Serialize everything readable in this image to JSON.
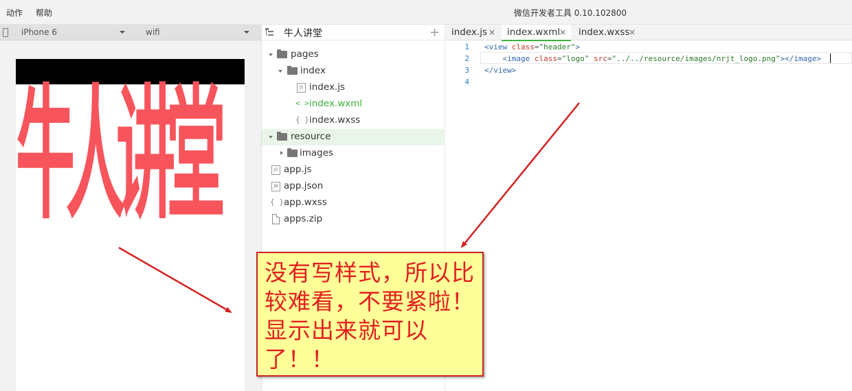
{
  "menu": {
    "action": "动作",
    "help": "帮助"
  },
  "app_title": "微信开发者工具 0.10.102800",
  "simulator": {
    "device_select": "iPhone 6",
    "network_select": "wifi",
    "logo_text": "牛人讲堂"
  },
  "file_tree": {
    "project_name": "牛人讲堂",
    "rows": [
      {
        "label": "pages",
        "icon": "folder-icon"
      },
      {
        "label": "index",
        "icon": "folder-icon"
      },
      {
        "label": "index.js",
        "icon": "js-file-icon",
        "badge": "JS"
      },
      {
        "label": "index.wxml",
        "icon": "code-tag-icon",
        "glyph": "< >"
      },
      {
        "label": "index.wxss",
        "icon": "braces-icon",
        "glyph": "{ }"
      },
      {
        "label": "resource",
        "icon": "folder-icon"
      },
      {
        "label": "images",
        "icon": "folder-icon"
      },
      {
        "label": "app.js",
        "icon": "js-file-icon",
        "badge": "JS"
      },
      {
        "label": "app.json",
        "icon": "json-file-icon",
        "badge": "JN"
      },
      {
        "label": "app.wxss",
        "icon": "braces-icon",
        "glyph": "{ }"
      },
      {
        "label": "apps.zip",
        "icon": "file-icon"
      }
    ]
  },
  "editor": {
    "tabs": [
      {
        "label": "index.js",
        "close": "×"
      },
      {
        "label": "index.wxml",
        "close": "×"
      },
      {
        "label": "index.wxss",
        "close": "×"
      }
    ],
    "line_numbers": [
      "1",
      "2",
      "3",
      "4"
    ],
    "code": {
      "l1_open": "<view ",
      "l1_attr": "class",
      "l1_eq": "=",
      "l1_val": "\"header\"",
      "l1_close": ">",
      "l2_indent": "    ",
      "l2_open": "<image ",
      "l2_attr1": "class",
      "l2_eq1": "=",
      "l2_val1": "\"logo\"",
      "l2_sp": " ",
      "l2_attr2": "src",
      "l2_eq2": "=",
      "l2_val2": "\"../../resource/images/nrjt_logo.png\"",
      "l2_close": "></image>",
      "l3": "</view>"
    }
  },
  "annotation": {
    "text": "没有写样式，所以比较难看，不要紧啦！显示出来就可以了！！"
  },
  "colors": {
    "accent_green": "#3cb13c",
    "logo_red": "#f7545c",
    "callout_bg": "#ffff99",
    "callout_text": "#e02020",
    "arrow_red": "#d42020"
  }
}
